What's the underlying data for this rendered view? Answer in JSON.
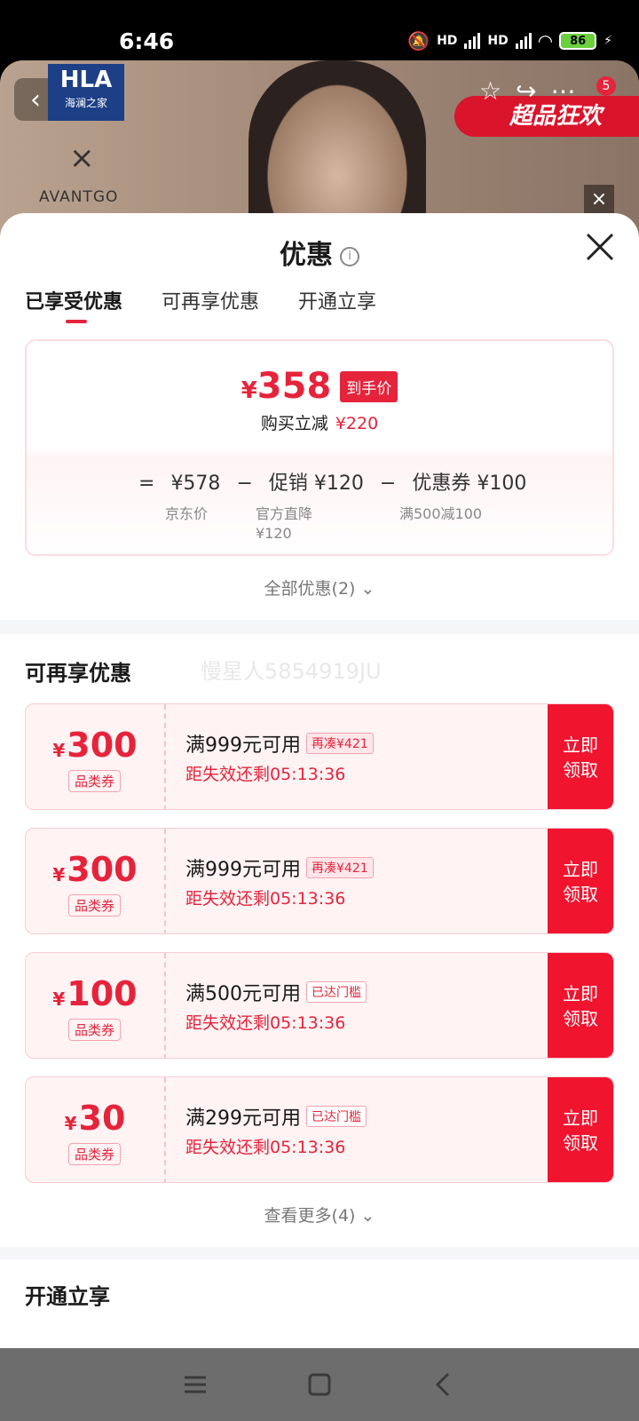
{
  "status": {
    "time": "6:46",
    "battery": "86",
    "network1": "HD",
    "network2": "HD"
  },
  "background": {
    "brand_name": "HLA",
    "brand_sub": "海澜之家",
    "collab_x": "×",
    "collab_brand": "AVANTGO",
    "promo_banner": "超品狂欢",
    "cart_count": "5"
  },
  "sheet": {
    "title": "优惠",
    "tabs": [
      {
        "label": "已享受优惠",
        "active": true
      },
      {
        "label": "可再享优惠",
        "active": false
      },
      {
        "label": "开通立享",
        "active": false
      }
    ],
    "summary": {
      "currency": "¥",
      "final_price": "358",
      "final_tag": "到手价",
      "instant_label": "购买立减",
      "instant_amount": "¥220",
      "eq": "=",
      "jd_price": "¥578",
      "minus": "−",
      "promo_label": "促销",
      "promo_amount": "¥120",
      "coupon_label": "优惠券",
      "coupon_amount": "¥100",
      "jd_price_label": "京东价",
      "promo_sub": "官方直降",
      "promo_sub_amount": "¥120",
      "coupon_sub": "满500减100"
    },
    "all_offers": "全部优惠(2)",
    "reenjoy_title": "可再享优惠",
    "watermark": "慢星人5854919JU",
    "coupons": [
      {
        "amount": "300",
        "type": "品类券",
        "condition": "满999元可用",
        "tag": "再凑¥421",
        "expire": "距失效还剩05:13:36",
        "button": "立即领取"
      },
      {
        "amount": "300",
        "type": "品类券",
        "condition": "满999元可用",
        "tag": "再凑¥421",
        "expire": "距失效还剩05:13:36",
        "button": "立即领取"
      },
      {
        "amount": "100",
        "type": "品类券",
        "condition": "满500元可用",
        "tag": "已达门槛",
        "expire": "距失效还剩05:13:36",
        "button": "立即领取"
      },
      {
        "amount": "30",
        "type": "品类券",
        "condition": "满299元可用",
        "tag": "已达门槛",
        "expire": "距失效还剩05:13:36",
        "button": "立即领取"
      }
    ],
    "see_more": "查看更多(4)",
    "open_title": "开通立享"
  },
  "colors": {
    "accent": "#e5243b",
    "button": "#f0142f",
    "nav": "#6d6d6d"
  }
}
